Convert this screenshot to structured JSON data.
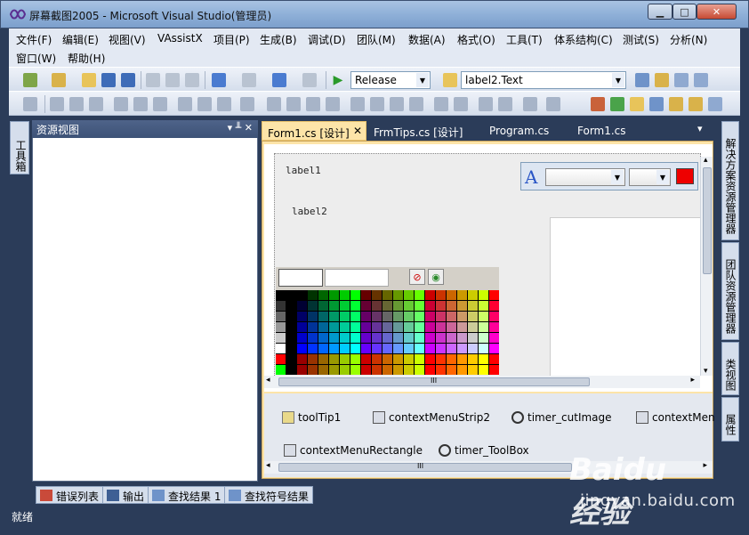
{
  "window": {
    "title": "屏幕截图2005 - Microsoft Visual Studio(管理员)",
    "minimize": "▁",
    "maximize": "□",
    "close": "✕"
  },
  "menu": [
    "文件(F)",
    "编辑(E)",
    "视图(V)",
    "VAssistX",
    "项目(P)",
    "生成(B)",
    "调试(D)",
    "团队(M)",
    "数据(A)",
    "格式(O)",
    "工具(T)",
    "体系结构(C)",
    "测试(S)",
    "分析(N)",
    "窗口(W)",
    "帮助(H)"
  ],
  "toolbar": {
    "configuration": "Release",
    "find_text": "label2.Text"
  },
  "left_dock": {
    "toolbox": "工具箱"
  },
  "resource_view": {
    "title": "资源视图",
    "controls": "▾ ╨ ✕"
  },
  "tabs": [
    {
      "label": "Form1.cs [设计]",
      "active": true,
      "close": "✕"
    },
    {
      "label": "FrmTips.cs [设计]"
    },
    {
      "label": "Program.cs"
    },
    {
      "label": "Form1.cs"
    }
  ],
  "tab_overflow": "▾",
  "designer": {
    "label1": "label1",
    "label2": "label2",
    "font_glyph": "A",
    "selected_color": "#ee0000"
  },
  "palette": {
    "no_color_icon": "⊘",
    "color_wheel_icon": "◉"
  },
  "scrollbars": {
    "grip": "III",
    "left": "◂",
    "right": "▸",
    "up": "▴",
    "down": "▾"
  },
  "components": [
    {
      "name": "toolTip1",
      "icon": "tooltip-icon"
    },
    {
      "name": "contextMenuStrip2",
      "icon": "context-menu-icon"
    },
    {
      "name": "timer_cutImage",
      "icon": "timer-icon"
    },
    {
      "name": "contextMen",
      "icon": "context-menu-icon"
    },
    {
      "name": "contextMenuRectangle",
      "icon": "context-menu-icon"
    },
    {
      "name": "timer_ToolBox",
      "icon": "timer-icon"
    }
  ],
  "right_dock": [
    {
      "label": "解决方案资源管理器"
    },
    {
      "label": "团队资源管理器"
    },
    {
      "label": "类视图"
    },
    {
      "label": "属性"
    }
  ],
  "bottom_tabs": [
    {
      "label": "错误列表"
    },
    {
      "label": "输出"
    },
    {
      "label": "查找结果 1"
    },
    {
      "label": "查找符号结果"
    }
  ],
  "status": "就绪",
  "watermark": {
    "logo": "Baidu经验",
    "url": "jingyan.baidu.com"
  }
}
